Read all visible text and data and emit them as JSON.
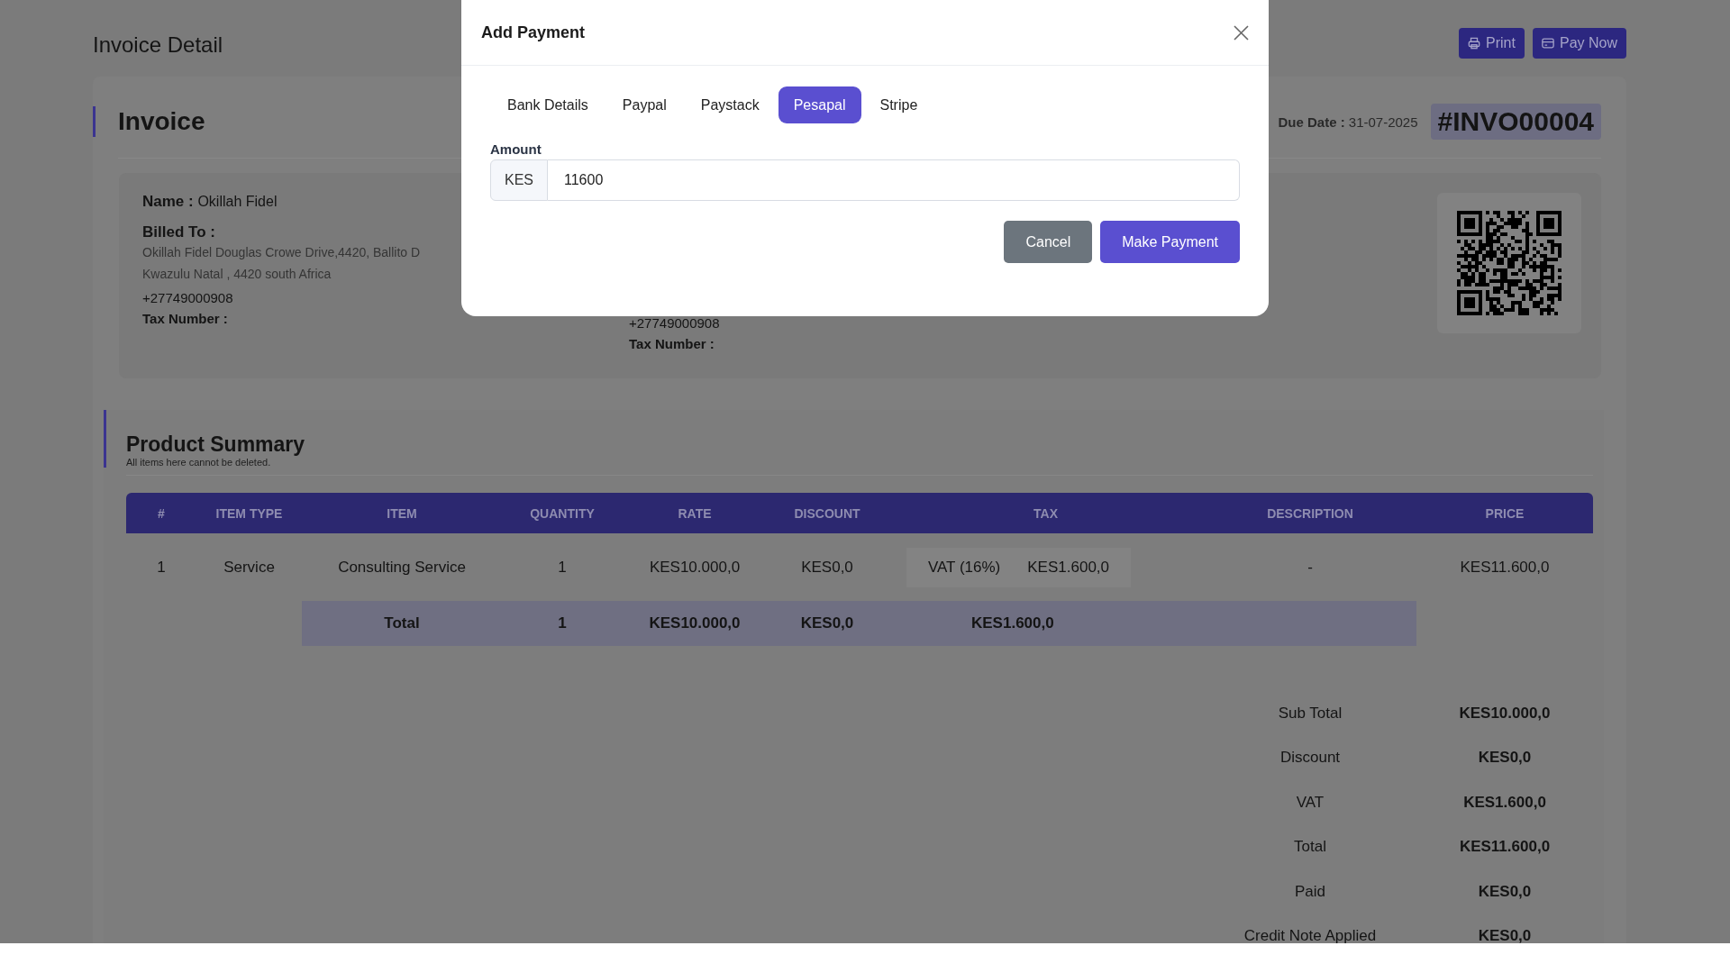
{
  "page": {
    "title": "Invoice Detail",
    "actions": [
      {
        "label": "Print"
      },
      {
        "label": "Pay Now"
      }
    ]
  },
  "invoice": {
    "heading": "Invoice",
    "due_label": "Due Date :",
    "due_date": "31-07-2025",
    "number": "#INVO00004",
    "customer": {
      "name_label": "Name :",
      "name": "Okillah Fidel",
      "billed_label": "Billed To :",
      "address": [
        "Okillah Fidel Douglas Crowe Drive,4420, Ballito D",
        "Kwazulu Natal , 4420 south Africa"
      ],
      "phone": "+27749000908",
      "tax_label": "Tax Number :"
    },
    "company": {
      "phone": "+27749000908",
      "tax_label": "Tax Number :"
    }
  },
  "product_summary": {
    "heading": "Product Summary",
    "subtitle": "All items here cannot be deleted.",
    "columns": [
      "#",
      "ITEM TYPE",
      "ITEM",
      "QUANTITY",
      "RATE",
      "DISCOUNT",
      "TAX",
      "DESCRIPTION",
      "PRICE"
    ],
    "rows": [
      {
        "cells": [
          "1",
          "Service",
          "Consulting Service",
          "1",
          "KES10.000,0",
          "KES0,0"
        ],
        "tax": [
          "VAT (16%)",
          "KES1.600,0"
        ],
        "description": "-",
        "price": "KES11.600,0"
      }
    ],
    "total_row": [
      "Total",
      "1",
      "KES10.000,0",
      "KES0,0",
      "KES1.600,0"
    ],
    "totals": [
      {
        "label": "Sub Total",
        "value": "KES10.000,0"
      },
      {
        "label": "Discount",
        "value": "KES0,0"
      },
      {
        "label": "VAT",
        "value": "KES1.600,0"
      },
      {
        "label": "Total",
        "value": "KES11.600,0"
      },
      {
        "label": "Paid",
        "value": "KES0,0"
      },
      {
        "label": "Credit Note Applied",
        "value": "KES0,0"
      }
    ]
  },
  "modal": {
    "title": "Add Payment",
    "tabs": [
      {
        "label": "Bank Details",
        "selected": false
      },
      {
        "label": "Paypal",
        "selected": false
      },
      {
        "label": "Paystack",
        "selected": false
      },
      {
        "label": "Pesapal",
        "selected": true
      },
      {
        "label": "Stripe",
        "selected": false
      }
    ],
    "amount_label": "Amount",
    "currency": "KES",
    "amount": "11600",
    "buttons": [
      {
        "label": "Cancel",
        "kind": "secondary"
      },
      {
        "label": "Make Payment",
        "kind": "primary"
      }
    ]
  }
}
